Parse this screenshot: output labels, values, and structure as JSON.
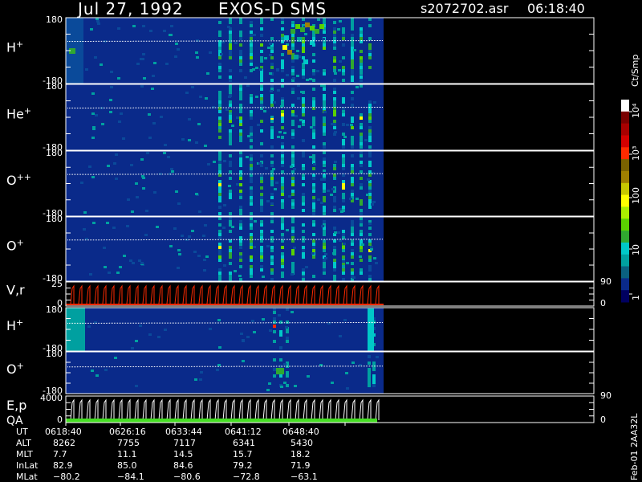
{
  "header": {
    "date": "Jul 27, 1992",
    "instrument": "EXOS-D SMS",
    "file": "s2072702.asr",
    "time": "06:18:40"
  },
  "colorbar": {
    "label": "Ct/Smp",
    "ticks": [
      "10⁴",
      "10³",
      "100",
      "10",
      "1"
    ],
    "colors": [
      "#ffffff",
      "#7a0000",
      "#a80000",
      "#d40000",
      "#ff2a00",
      "#7a6200",
      "#a08000",
      "#c8c800",
      "#ffff00",
      "#aaee00",
      "#5ad200",
      "#30a830",
      "#00c8c8",
      "#00a0a0",
      "#0a6080",
      "#0a2a8a",
      "#000060"
    ]
  },
  "chart_data": {
    "type": "heatmap",
    "panels": [
      {
        "species": "H",
        "charge": "+",
        "y_ticks": [
          "180",
          "-180"
        ]
      },
      {
        "species": "He",
        "charge": "+",
        "y_ticks": [
          "180",
          "-180"
        ]
      },
      {
        "species": "O",
        "charge": "++",
        "y_ticks": [
          "180",
          "-180"
        ]
      },
      {
        "species": "O",
        "charge": "+",
        "y_ticks": [
          "180",
          "-180"
        ]
      },
      {
        "species": "V,r",
        "charge": "",
        "y_ticks": [
          "25",
          "0"
        ],
        "right_ticks": [
          "90",
          "0"
        ]
      },
      {
        "species": "H",
        "charge": "+",
        "y_ticks": [
          "180",
          "-180"
        ]
      },
      {
        "species": "O",
        "charge": "+",
        "y_ticks": [
          "180",
          "-180"
        ]
      },
      {
        "species": "E,p",
        "charge": "",
        "extra_label": "QA",
        "y_ticks": [
          "4000",
          "0"
        ],
        "right_ticks": [
          "90",
          "0"
        ]
      }
    ],
    "x_labels": [
      "UT",
      "ALT",
      "MLT",
      "InLat",
      "MLat"
    ],
    "x_ticks": [
      {
        "UT": "0618:40",
        "ALT": "8262",
        "MLT": "7.7",
        "InLat": "82.9",
        "MLat": "−80.2"
      },
      {
        "UT": "0626:16",
        "ALT": "7755",
        "MLT": "11.1",
        "InLat": "85.0",
        "MLat": "−84.1"
      },
      {
        "UT": "0633:44",
        "ALT": "7117",
        "MLT": "14.5",
        "InLat": "84.6",
        "MLat": "−80.6"
      },
      {
        "UT": "0641:12",
        "ALT": "6341",
        "MLT": "15.7",
        "InLat": "79.2",
        "MLat": "−72.8"
      },
      {
        "UT": "0648:40",
        "ALT": "5430",
        "MLT": "18.2",
        "InLat": "71.9",
        "MLat": "−63.1"
      }
    ]
  },
  "side_label": "Feb-01 2AA32L"
}
